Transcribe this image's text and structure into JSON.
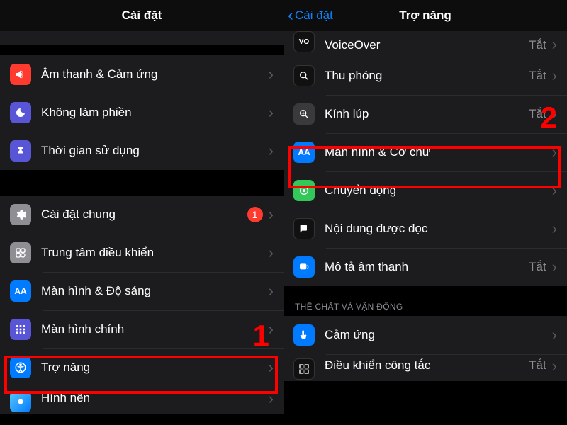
{
  "left": {
    "title": "Cài đặt",
    "groups": [
      [
        {
          "icon": "sound-icon",
          "bg": "bg-red",
          "label": "Âm thanh & Cảm ứng"
        },
        {
          "icon": "moon-icon",
          "bg": "bg-purple",
          "label": "Không làm phiền"
        },
        {
          "icon": "hourglass-icon",
          "bg": "bg-indigo",
          "label": "Thời gian sử dụng"
        }
      ],
      [
        {
          "icon": "gear-icon",
          "bg": "bg-gray",
          "label": "Cài đặt chung",
          "badge": "1"
        },
        {
          "icon": "control-center-icon",
          "bg": "bg-gray",
          "label": "Trung tâm điều khiển"
        },
        {
          "icon": "aa-icon",
          "bg": "bg-blue",
          "label": "Màn hình & Độ sáng"
        },
        {
          "icon": "grid-icon",
          "bg": "bg-indigo",
          "label": "Màn hình chính"
        },
        {
          "icon": "accessibility-icon",
          "bg": "bg-blue",
          "label": "Trợ năng"
        },
        {
          "icon": "wallpaper-icon",
          "bg": "bg-blue",
          "label": "Hình nền"
        }
      ]
    ],
    "annotation": {
      "step": "1"
    }
  },
  "right": {
    "back": "Cài đặt",
    "title": "Trợ năng",
    "rows": [
      {
        "icon": "voiceover-icon",
        "bg": "bg-black",
        "label": "VoiceOver",
        "value": "Tắt",
        "partial": "top"
      },
      {
        "icon": "zoom-icon",
        "bg": "bg-black",
        "label": "Thu phóng",
        "value": "Tắt"
      },
      {
        "icon": "magnifier-icon",
        "bg": "bg-darkgray",
        "label": "Kính lúp",
        "value": "Tắt"
      },
      {
        "icon": "aa-icon",
        "bg": "bg-blue",
        "label": "Màn hình & Cỡ chữ"
      },
      {
        "icon": "motion-icon",
        "bg": "bg-green",
        "label": "Chuyển động"
      },
      {
        "icon": "spoken-icon",
        "bg": "bg-black",
        "label": "Nội dung được đọc"
      },
      {
        "icon": "audio-desc-icon",
        "bg": "bg-blue",
        "label": "Mô tả âm thanh",
        "value": "Tắt"
      }
    ],
    "section2_header": "THỂ CHẤT VÀ VẬN ĐỘNG",
    "rows2": [
      {
        "icon": "touch-icon",
        "bg": "bg-blue",
        "label": "Cảm ứng"
      },
      {
        "icon": "switch-icon",
        "bg": "bg-black",
        "label": "Điều khiển công tắc",
        "value": "Tắt",
        "partial": "bottom"
      }
    ],
    "annotation": {
      "step": "2"
    }
  }
}
